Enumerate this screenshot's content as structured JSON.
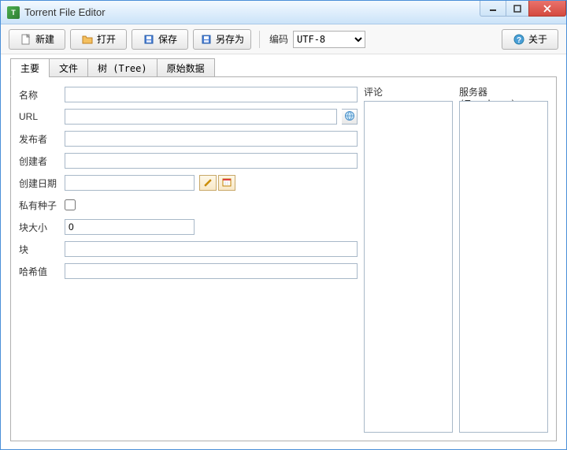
{
  "window": {
    "title": "Torrent File Editor"
  },
  "toolbar": {
    "new": "新建",
    "open": "打开",
    "save": "保存",
    "save_as": "另存为",
    "encoding_label": "编码",
    "encoding_value": "UTF-8",
    "about": "关于"
  },
  "tabs": [
    {
      "id": "main",
      "label": "主要"
    },
    {
      "id": "files",
      "label": "文件"
    },
    {
      "id": "tree",
      "label": "树 (Tree)"
    },
    {
      "id": "raw",
      "label": "原始数据"
    }
  ],
  "form": {
    "name_label": "名称",
    "name_value": "",
    "url_label": "URL",
    "url_value": "",
    "publisher_label": "发布者",
    "publisher_value": "",
    "creator_label": "创建者",
    "creator_value": "",
    "date_label": "创建日期",
    "date_value": "",
    "private_label": "私有种子",
    "private_checked": false,
    "piece_size_label": "块大小",
    "piece_size_value": "0",
    "pieces_label": "块",
    "pieces_value": "",
    "hash_label": "哈希值",
    "hash_value": ""
  },
  "columns": {
    "comment_header": "评论",
    "trackers_header": "服务器 (Trackers)"
  }
}
